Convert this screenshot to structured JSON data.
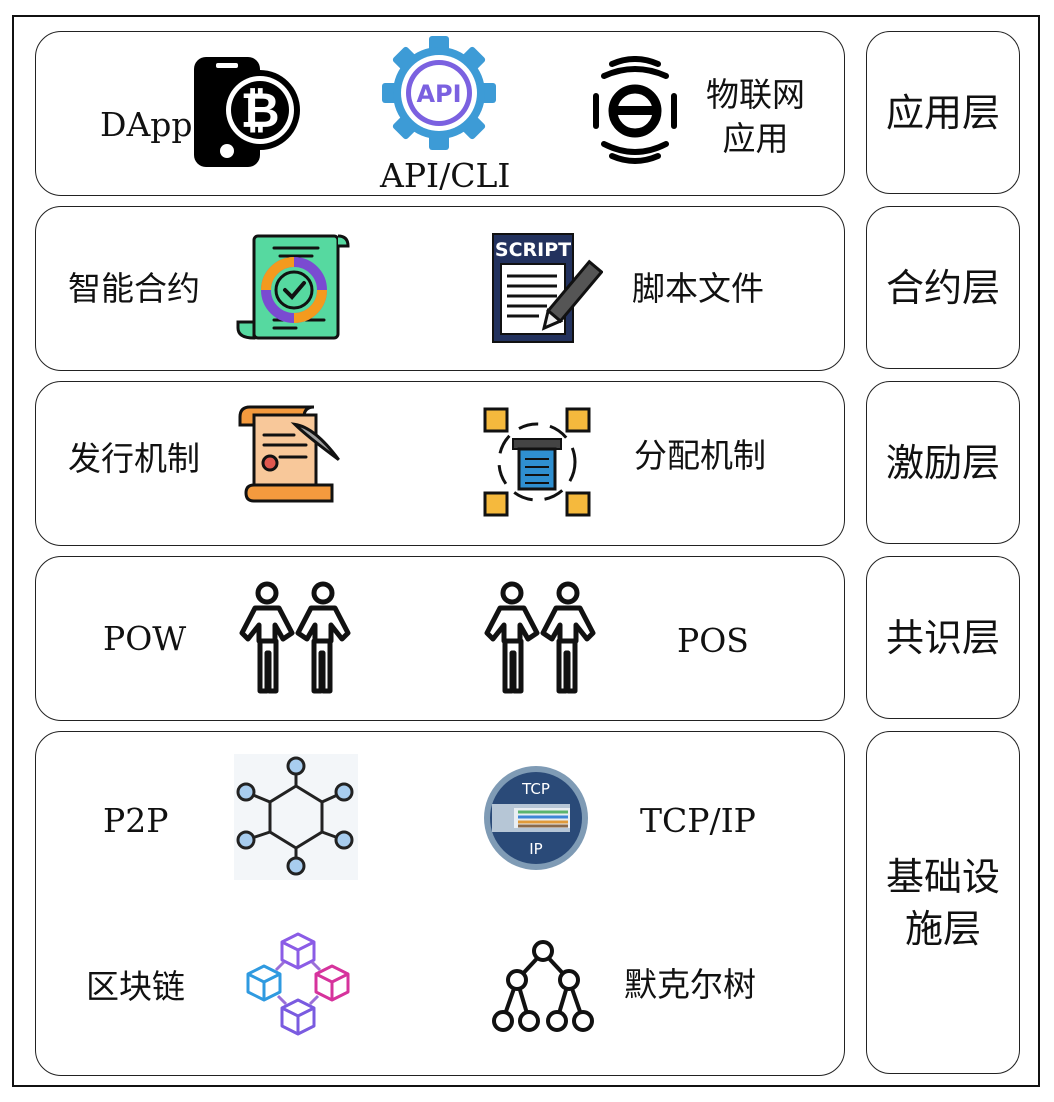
{
  "layers": [
    {
      "id": "app",
      "name": "应用层",
      "items": [
        "DApp",
        "API/CLI",
        "物联网\n应用"
      ],
      "icon_names": [
        "bitcoin-phone-icon",
        "api-gear-icon",
        "iot-icon"
      ]
    },
    {
      "id": "contract",
      "name": "合约层",
      "items": [
        "智能合约",
        "脚本文件"
      ],
      "icon_names": [
        "smart-contract-icon",
        "script-file-icon"
      ]
    },
    {
      "id": "incentive",
      "name": "激励层",
      "items": [
        "发行机制",
        "分配机制"
      ],
      "icon_names": [
        "issuance-scroll-icon",
        "distribution-boxes-icon"
      ]
    },
    {
      "id": "consensus",
      "name": "共识层",
      "items": [
        "POW",
        "POS"
      ],
      "icon_names": [
        "handshake-people-icon",
        "handshake-people-icon"
      ]
    },
    {
      "id": "infra",
      "name": "基础设\n施层",
      "items": [
        "P2P",
        "TCP/IP",
        "区块链",
        "默克尔树"
      ],
      "icon_names": [
        "p2p-network-icon",
        "tcp-ip-cable-icon",
        "blockchain-cubes-icon",
        "merkle-tree-icon"
      ]
    }
  ],
  "icon_text": {
    "api": "API",
    "script": "SCRIPT",
    "tcp": "TCP",
    "ip": "IP"
  },
  "colors": {
    "contract_green": "#56d9a0",
    "contract_purple": "#7a4bd1",
    "contract_orange": "#f49a1e",
    "script_navy": "#23325e",
    "scroll_tan": "#f8c89a",
    "box_yellow": "#f5b93d",
    "api_blue": "#3d9bd6",
    "api_purple": "#7b61e0",
    "network_blue": "#a8cdef",
    "tcp_navy": "#2a4a78"
  }
}
